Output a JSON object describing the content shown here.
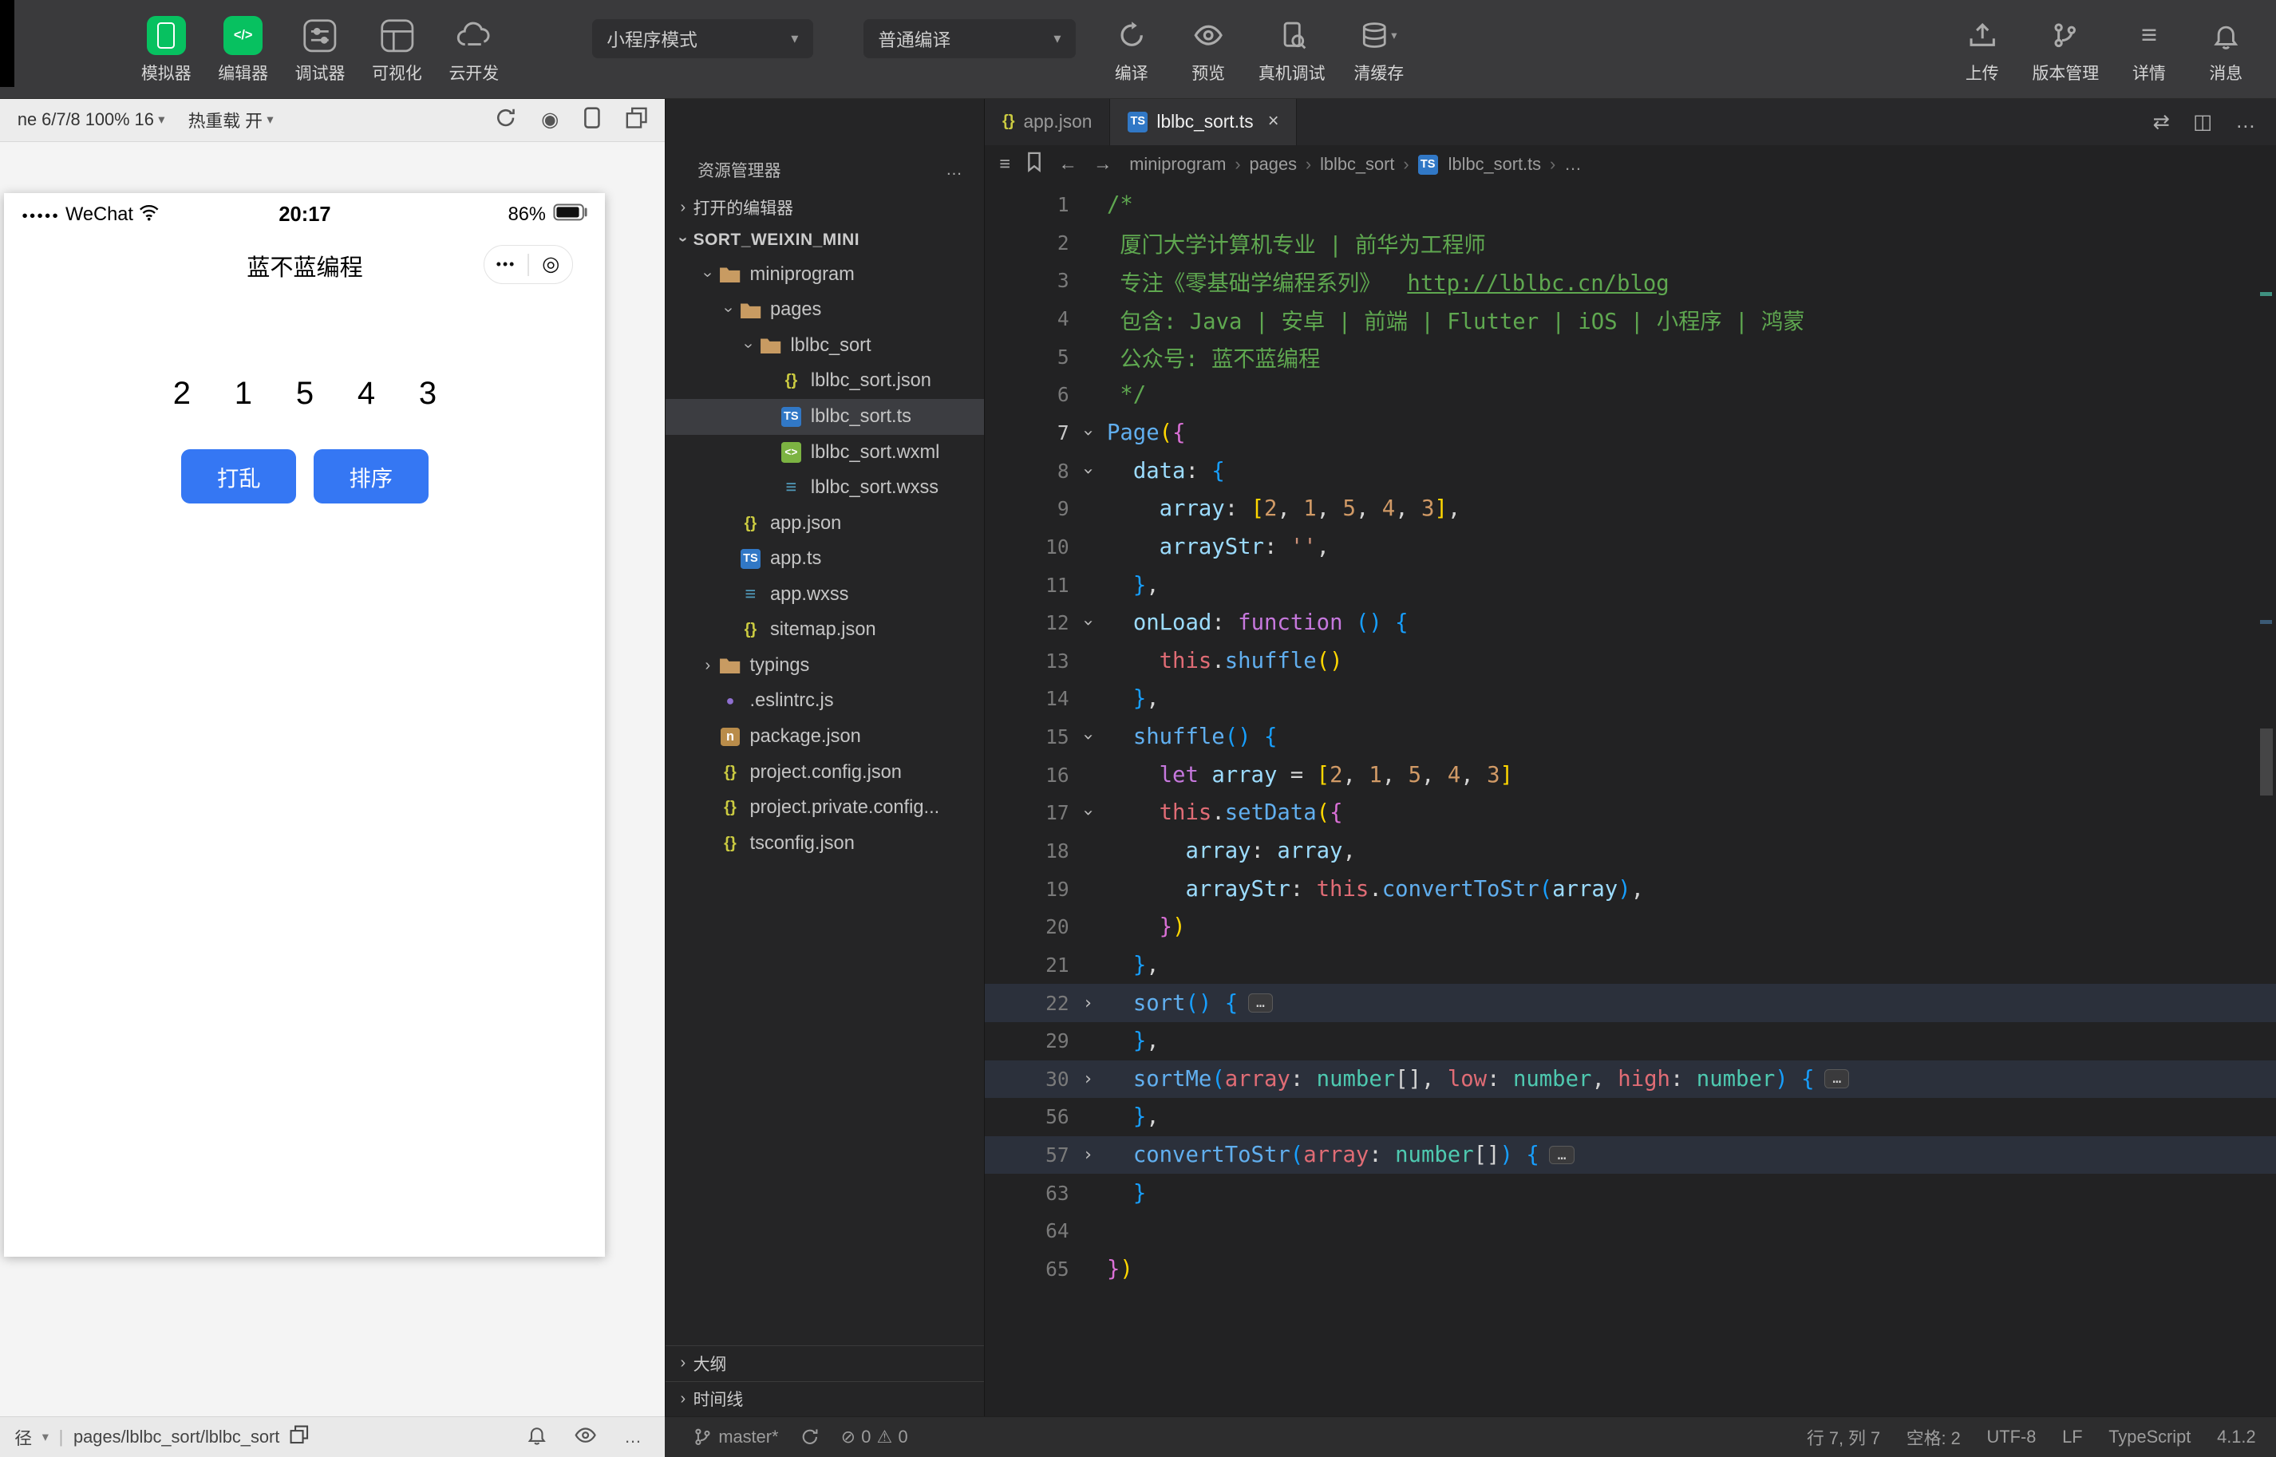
{
  "icons": {
    "caret": "▾",
    "chevron": "›",
    "more": "…",
    "close": "×",
    "record": "◉",
    "hamburger": "≡",
    "ellipsis": "…",
    "error": "⊘",
    "warning": "⚠",
    "signal_dots": "●●●●●",
    "capsule_dots": "•••",
    "capsule_target": "◎",
    "divider": "|",
    "back": "←",
    "forward": "→",
    "breadcrumb_sep": "›",
    "swap": "⇄",
    "split": "◫"
  },
  "toolbar": {
    "tools": [
      {
        "label": "模拟器"
      },
      {
        "label": "编辑器"
      },
      {
        "label": "调试器"
      },
      {
        "label": "可视化"
      },
      {
        "label": "云开发"
      }
    ],
    "mode_dropdown": "小程序模式",
    "compile_dropdown": "普通编译",
    "actions": [
      {
        "label": "编译"
      },
      {
        "label": "预览"
      },
      {
        "label": "真机调试"
      },
      {
        "label": "清缓存"
      }
    ],
    "right_actions": [
      {
        "label": "上传"
      },
      {
        "label": "版本管理"
      },
      {
        "label": "详情"
      },
      {
        "label": "消息"
      }
    ]
  },
  "simulator": {
    "device_label": "ne 6/7/8 100% 16",
    "hot_reload_label": "热重载 开",
    "phone": {
      "carrier": "WeChat",
      "time": "20:17",
      "battery": "86%",
      "nav_title": "蓝不蓝编程",
      "numbers": "2 1 5 4 3",
      "buttons": [
        {
          "label": "打乱"
        },
        {
          "label": "排序"
        }
      ]
    }
  },
  "explorer": {
    "title": "资源管理器",
    "open_editors_label": "打开的编辑器",
    "project_label": "SORT_WEIXIN_MINI",
    "outline_label": "大纲",
    "timeline_label": "时间线",
    "tree": [
      {
        "label": "miniprogram",
        "type": "folder",
        "level": 1,
        "expanded": true
      },
      {
        "label": "pages",
        "type": "folder",
        "level": 2,
        "expanded": true
      },
      {
        "label": "lblbc_sort",
        "type": "folder",
        "level": 3,
        "expanded": true
      },
      {
        "label": "lblbc_sort.json",
        "type": "json",
        "level": 4
      },
      {
        "label": "lblbc_sort.ts",
        "type": "ts",
        "level": 4,
        "selected": true
      },
      {
        "label": "lblbc_sort.wxml",
        "type": "wxml",
        "level": 4
      },
      {
        "label": "lblbc_sort.wxss",
        "type": "wxss",
        "level": 4
      },
      {
        "label": "app.json",
        "type": "json",
        "level": 2
      },
      {
        "label": "app.ts",
        "type": "ts",
        "level": 2
      },
      {
        "label": "app.wxss",
        "type": "wxss",
        "level": 2
      },
      {
        "label": "sitemap.json",
        "type": "json",
        "level": 2
      },
      {
        "label": "typings",
        "type": "folder",
        "level": 1,
        "expanded": false
      },
      {
        "label": ".eslintrc.js",
        "type": "eslint",
        "level": 1
      },
      {
        "label": "package.json",
        "type": "npm",
        "level": 1
      },
      {
        "label": "project.config.json",
        "type": "json",
        "level": 1
      },
      {
        "label": "project.private.config...",
        "type": "json",
        "level": 1
      },
      {
        "label": "tsconfig.json",
        "type": "json",
        "level": 1
      }
    ]
  },
  "editor": {
    "tabs": [
      {
        "label": "app.json",
        "icon": "json",
        "active": false
      },
      {
        "label": "lblbc_sort.ts",
        "icon": "ts",
        "active": true
      }
    ],
    "breadcrumb": [
      {
        "label": "miniprogram"
      },
      {
        "label": "pages"
      },
      {
        "label": "lblbc_sort"
      },
      {
        "label": "lblbc_sort.ts",
        "icon": "ts"
      },
      {
        "label": "…"
      }
    ],
    "code_lines": [
      {
        "n": 1,
        "seg": [
          [
            "/*",
            "com"
          ]
        ]
      },
      {
        "n": 2,
        "seg": [
          [
            " 厦门大学计算机专业 | 前华为工程师",
            "com"
          ]
        ]
      },
      {
        "n": 3,
        "seg": [
          [
            " 专注《零基础学编程系列》  ",
            "com"
          ],
          [
            "http://lblbc.cn/blog",
            "url"
          ]
        ]
      },
      {
        "n": 4,
        "seg": [
          [
            " 包含: Java | 安卓 | 前端 | Flutter | iOS | 小程序 | 鸿蒙",
            "com"
          ]
        ]
      },
      {
        "n": 5,
        "seg": [
          [
            " 公众号: 蓝不蓝编程",
            "com"
          ]
        ]
      },
      {
        "n": 6,
        "seg": [
          [
            " */",
            "com"
          ]
        ]
      },
      {
        "n": 7,
        "fold": "open",
        "cur": true,
        "seg": [
          [
            "Page",
            "fn"
          ],
          [
            "(",
            "b1"
          ],
          [
            "{",
            "b2"
          ]
        ]
      },
      {
        "n": 8,
        "fold": "open",
        "seg": [
          [
            "  ",
            "def"
          ],
          [
            "data",
            "pr"
          ],
          [
            ": ",
            "def"
          ],
          [
            "{",
            "b3"
          ]
        ]
      },
      {
        "n": 9,
        "seg": [
          [
            "    ",
            "def"
          ],
          [
            "array",
            "pr"
          ],
          [
            ": ",
            "def"
          ],
          [
            "[",
            "b1"
          ],
          [
            "2",
            "num"
          ],
          [
            ", ",
            "def"
          ],
          [
            "1",
            "num"
          ],
          [
            ", ",
            "def"
          ],
          [
            "5",
            "num"
          ],
          [
            ", ",
            "def"
          ],
          [
            "4",
            "num"
          ],
          [
            ", ",
            "def"
          ],
          [
            "3",
            "num"
          ],
          [
            "]",
            "b1"
          ],
          [
            ",",
            "def"
          ]
        ]
      },
      {
        "n": 10,
        "seg": [
          [
            "    ",
            "def"
          ],
          [
            "arrayStr",
            "pr"
          ],
          [
            ": ",
            "def"
          ],
          [
            "''",
            "str"
          ],
          [
            ",",
            "def"
          ]
        ]
      },
      {
        "n": 11,
        "seg": [
          [
            "  ",
            "def"
          ],
          [
            "}",
            "b3"
          ],
          [
            ",",
            "def"
          ]
        ]
      },
      {
        "n": 12,
        "fold": "open",
        "seg": [
          [
            "  ",
            "def"
          ],
          [
            "onLoad",
            "pr"
          ],
          [
            ": ",
            "def"
          ],
          [
            "function",
            "kw"
          ],
          [
            " ",
            "def"
          ],
          [
            "(",
            "b3"
          ],
          [
            ")",
            "b3"
          ],
          [
            " ",
            "def"
          ],
          [
            "{",
            "b3"
          ]
        ]
      },
      {
        "n": 13,
        "seg": [
          [
            "    ",
            "def"
          ],
          [
            "this",
            "th"
          ],
          [
            ".",
            "def"
          ],
          [
            "shuffle",
            "fn"
          ],
          [
            "(",
            "b1"
          ],
          [
            ")",
            "b1"
          ]
        ]
      },
      {
        "n": 14,
        "seg": [
          [
            "  ",
            "def"
          ],
          [
            "}",
            "b3"
          ],
          [
            ",",
            "def"
          ]
        ]
      },
      {
        "n": 15,
        "fold": "open",
        "seg": [
          [
            "  ",
            "def"
          ],
          [
            "shuffle",
            "fn"
          ],
          [
            "(",
            "b3"
          ],
          [
            ")",
            "b3"
          ],
          [
            " ",
            "def"
          ],
          [
            "{",
            "b3"
          ]
        ]
      },
      {
        "n": 16,
        "seg": [
          [
            "    ",
            "def"
          ],
          [
            "let",
            "kw"
          ],
          [
            " ",
            "def"
          ],
          [
            "array",
            "pr"
          ],
          [
            " = ",
            "def"
          ],
          [
            "[",
            "b1"
          ],
          [
            "2",
            "num"
          ],
          [
            ", ",
            "def"
          ],
          [
            "1",
            "num"
          ],
          [
            ", ",
            "def"
          ],
          [
            "5",
            "num"
          ],
          [
            ", ",
            "def"
          ],
          [
            "4",
            "num"
          ],
          [
            ", ",
            "def"
          ],
          [
            "3",
            "num"
          ],
          [
            "]",
            "b1"
          ]
        ]
      },
      {
        "n": 17,
        "fold": "open",
        "seg": [
          [
            "    ",
            "def"
          ],
          [
            "this",
            "th"
          ],
          [
            ".",
            "def"
          ],
          [
            "setData",
            "fn"
          ],
          [
            "(",
            "b1"
          ],
          [
            "{",
            "b2"
          ]
        ]
      },
      {
        "n": 18,
        "seg": [
          [
            "      ",
            "def"
          ],
          [
            "array",
            "pr"
          ],
          [
            ": ",
            "def"
          ],
          [
            "array",
            "pr"
          ],
          [
            ",",
            "def"
          ]
        ]
      },
      {
        "n": 19,
        "seg": [
          [
            "      ",
            "def"
          ],
          [
            "arrayStr",
            "pr"
          ],
          [
            ": ",
            "def"
          ],
          [
            "this",
            "th"
          ],
          [
            ".",
            "def"
          ],
          [
            "convertToStr",
            "fn"
          ],
          [
            "(",
            "b3"
          ],
          [
            "array",
            "pr"
          ],
          [
            ")",
            "b3"
          ],
          [
            ",",
            "def"
          ]
        ]
      },
      {
        "n": 20,
        "seg": [
          [
            "    ",
            "def"
          ],
          [
            "}",
            "b2"
          ],
          [
            ")",
            "b1"
          ]
        ]
      },
      {
        "n": 21,
        "seg": [
          [
            "  ",
            "def"
          ],
          [
            "}",
            "b3"
          ],
          [
            ",",
            "def"
          ]
        ]
      },
      {
        "n": 22,
        "fold": "closed",
        "hl": true,
        "badge": true,
        "seg": [
          [
            "  ",
            "def"
          ],
          [
            "sort",
            "fn"
          ],
          [
            "(",
            "b3"
          ],
          [
            ")",
            "b3"
          ],
          [
            " ",
            "def"
          ],
          [
            "{",
            "b3"
          ]
        ]
      },
      {
        "n": 29,
        "seg": [
          [
            "  ",
            "def"
          ],
          [
            "}",
            "b3"
          ],
          [
            ",",
            "def"
          ]
        ]
      },
      {
        "n": 30,
        "fold": "closed",
        "hl": true,
        "badge": true,
        "seg": [
          [
            "  ",
            "def"
          ],
          [
            "sortMe",
            "fn"
          ],
          [
            "(",
            "b3"
          ],
          [
            "array",
            "par"
          ],
          [
            ": ",
            "def"
          ],
          [
            "number",
            "typ"
          ],
          [
            "[]",
            "def"
          ],
          [
            ", ",
            "def"
          ],
          [
            "low",
            "par"
          ],
          [
            ": ",
            "def"
          ],
          [
            "number",
            "typ"
          ],
          [
            ", ",
            "def"
          ],
          [
            "high",
            "par"
          ],
          [
            ": ",
            "def"
          ],
          [
            "number",
            "typ"
          ],
          [
            ")",
            "b3"
          ],
          [
            " ",
            "def"
          ],
          [
            "{",
            "b3"
          ]
        ]
      },
      {
        "n": 56,
        "seg": [
          [
            "  ",
            "def"
          ],
          [
            "}",
            "b3"
          ],
          [
            ",",
            "def"
          ]
        ]
      },
      {
        "n": 57,
        "fold": "closed",
        "hl": true,
        "badge": true,
        "seg": [
          [
            "  ",
            "def"
          ],
          [
            "convertToStr",
            "fn"
          ],
          [
            "(",
            "b3"
          ],
          [
            "array",
            "par"
          ],
          [
            ": ",
            "def"
          ],
          [
            "number",
            "typ"
          ],
          [
            "[]",
            "def"
          ],
          [
            ")",
            "b3"
          ],
          [
            " ",
            "def"
          ],
          [
            "{",
            "b3"
          ]
        ]
      },
      {
        "n": 63,
        "seg": [
          [
            "  ",
            "def"
          ],
          [
            "}",
            "b3"
          ]
        ]
      },
      {
        "n": 64,
        "seg": []
      },
      {
        "n": 65,
        "seg": [
          [
            "}",
            "b2"
          ],
          [
            ")",
            "b1"
          ]
        ]
      }
    ]
  },
  "statusbar": {
    "path_prefix": "径",
    "path": "pages/lblbc_sort/lblbc_sort",
    "branch": "master*",
    "errors": "0",
    "warnings": "0",
    "cursor": "行 7, 列 7",
    "indent": "空格: 2",
    "encoding": "UTF-8",
    "eol": "LF",
    "language": "TypeScript",
    "version": "4.1.2"
  }
}
